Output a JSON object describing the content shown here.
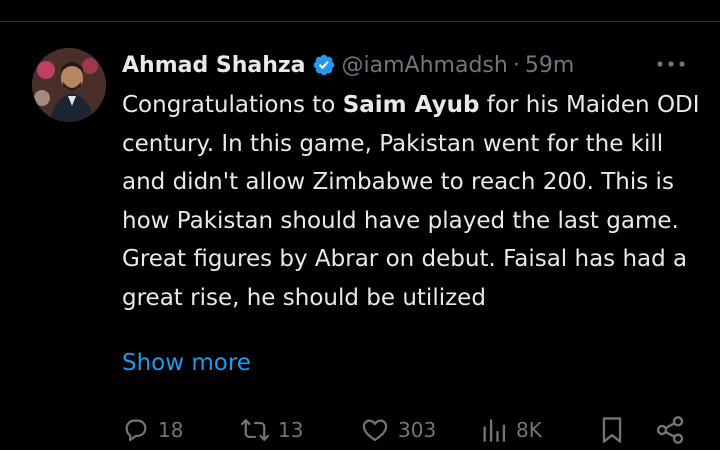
{
  "tweet": {
    "author_name": "Ahmad Shahza",
    "handle": "@iamAhmadsh",
    "separator": "·",
    "time": "59m",
    "text_parts": [
      "Congratulations to ",
      "Saim Ayub",
      " for his Maiden ODI century.  In this game, Pakistan went for the kill and didn't allow Zimbabwe to reach 200. This is how Pakistan should have played the last game. Great figures by Abrar on debut. Faisal has had a great rise, he should be utilized"
    ],
    "show_more_label": "Show more"
  },
  "actions": {
    "replies": "18",
    "reposts": "13",
    "likes": "303",
    "views": "8K"
  },
  "icons": {
    "verified": "verified-badge-icon",
    "more": "more-dots-icon",
    "reply": "reply-icon",
    "repost": "repost-icon",
    "like": "heart-icon",
    "views": "views-icon",
    "bookmark": "bookmark-icon",
    "share": "share-icon"
  },
  "colors": {
    "background": "#000000",
    "text": "#e7e9ea",
    "muted": "#71767b",
    "link": "#1d9bf0",
    "verified": "#1d9bf0"
  }
}
